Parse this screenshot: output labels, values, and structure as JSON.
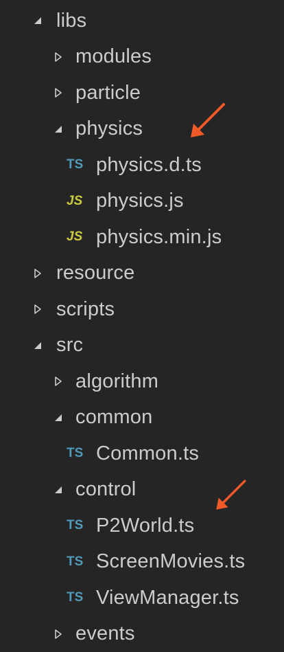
{
  "colors": {
    "background": "#252526",
    "text": "#cccccc",
    "ts_icon": "#519aba",
    "js_icon": "#cbcb41",
    "annotation_arrow": "#f05a28"
  },
  "icons": {
    "expanded": "triangle-down",
    "collapsed": "triangle-right",
    "annotation": "red-arrow"
  },
  "tree": [
    {
      "label": "libs",
      "type": "folder",
      "expanded": true,
      "level": 0
    },
    {
      "label": "modules",
      "type": "folder",
      "expanded": false,
      "level": 1
    },
    {
      "label": "particle",
      "type": "folder",
      "expanded": false,
      "level": 1
    },
    {
      "label": "physics",
      "type": "folder",
      "expanded": true,
      "level": 1,
      "annotated": true
    },
    {
      "label": "physics.d.ts",
      "type": "file",
      "icon": "TS",
      "level": 2
    },
    {
      "label": "physics.js",
      "type": "file",
      "icon": "JS",
      "level": 2
    },
    {
      "label": "physics.min.js",
      "type": "file",
      "icon": "JS",
      "level": 2
    },
    {
      "label": "resource",
      "type": "folder",
      "expanded": false,
      "level": 0
    },
    {
      "label": "scripts",
      "type": "folder",
      "expanded": false,
      "level": 0
    },
    {
      "label": "src",
      "type": "folder",
      "expanded": true,
      "level": 0
    },
    {
      "label": "algorithm",
      "type": "folder",
      "expanded": false,
      "level": 1
    },
    {
      "label": "common",
      "type": "folder",
      "expanded": true,
      "level": 1
    },
    {
      "label": "Common.ts",
      "type": "file",
      "icon": "TS",
      "level": 2
    },
    {
      "label": "control",
      "type": "folder",
      "expanded": true,
      "level": 1,
      "annotated": true
    },
    {
      "label": "P2World.ts",
      "type": "file",
      "icon": "TS",
      "level": 2
    },
    {
      "label": "ScreenMovies.ts",
      "type": "file",
      "icon": "TS",
      "level": 2
    },
    {
      "label": "ViewManager.ts",
      "type": "file",
      "icon": "TS",
      "level": 2
    },
    {
      "label": "events",
      "type": "folder",
      "expanded": false,
      "level": 1
    }
  ]
}
